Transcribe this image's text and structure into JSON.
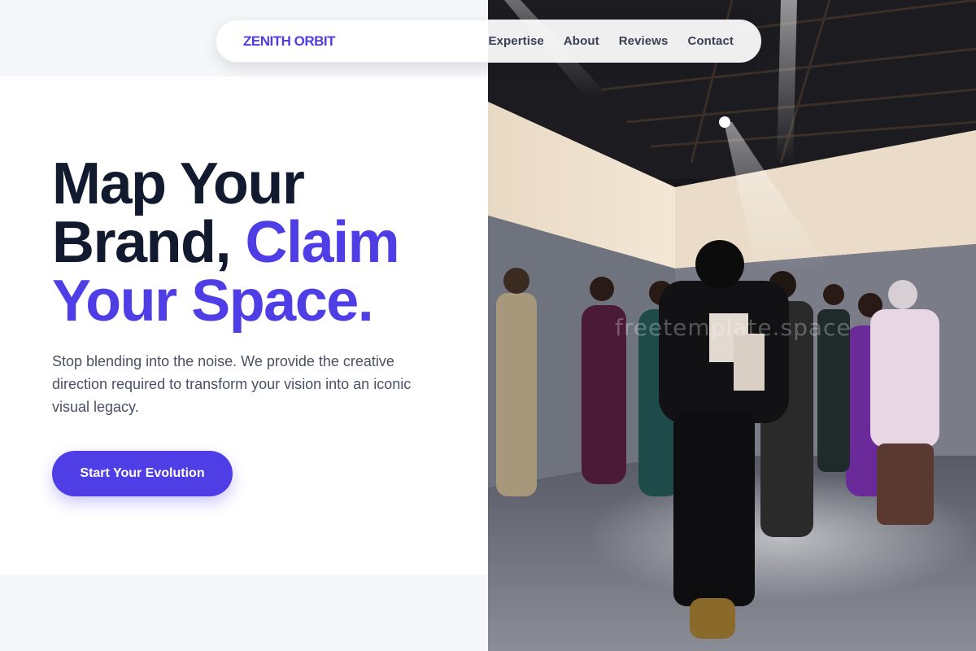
{
  "brand": {
    "logo": "ZENITH ORBIT",
    "accent_color": "#4f3ee6"
  },
  "nav": {
    "links": [
      {
        "label": "Expertise"
      },
      {
        "label": "About"
      },
      {
        "label": "Reviews"
      },
      {
        "label": "Contact"
      }
    ]
  },
  "hero": {
    "title_part1": "Map Your",
    "title_part2": "Brand,",
    "title_accent1": "Claim",
    "title_accent2": "Your Space.",
    "subtitle": "Stop blending into the noise. We provide the creative direction required to transform your vision into an iconic visual legacy.",
    "cta_label": "Start Your Evolution"
  },
  "photo": {
    "watermark": "freetemplate.space"
  },
  "colors": {
    "heading": "#111a2e",
    "body_text": "#4a5164",
    "nav_text": "#3a4154"
  }
}
